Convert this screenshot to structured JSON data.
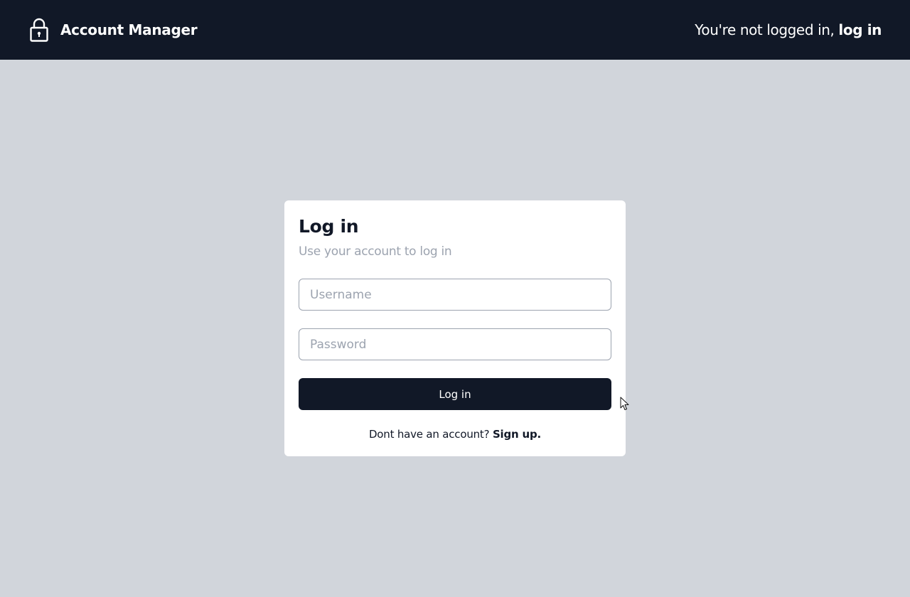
{
  "header": {
    "app_name": "Account Manager",
    "logo_icon": "lock-icon",
    "status_text": "You're not logged in, ",
    "login_link": "log in"
  },
  "login_card": {
    "title": "Log in",
    "subtitle": "Use your account to log in",
    "username": {
      "value": "",
      "placeholder": "Username"
    },
    "password": {
      "value": "",
      "placeholder": "Password"
    },
    "submit_label": "Log in",
    "signup_prompt": "Dont have an account? ",
    "signup_link": "Sign up."
  },
  "colors": {
    "nav_background": "#111827",
    "page_background": "#d1d5db",
    "card_background": "#ffffff",
    "button_background": "#111827",
    "muted_text": "#9ca3af"
  }
}
